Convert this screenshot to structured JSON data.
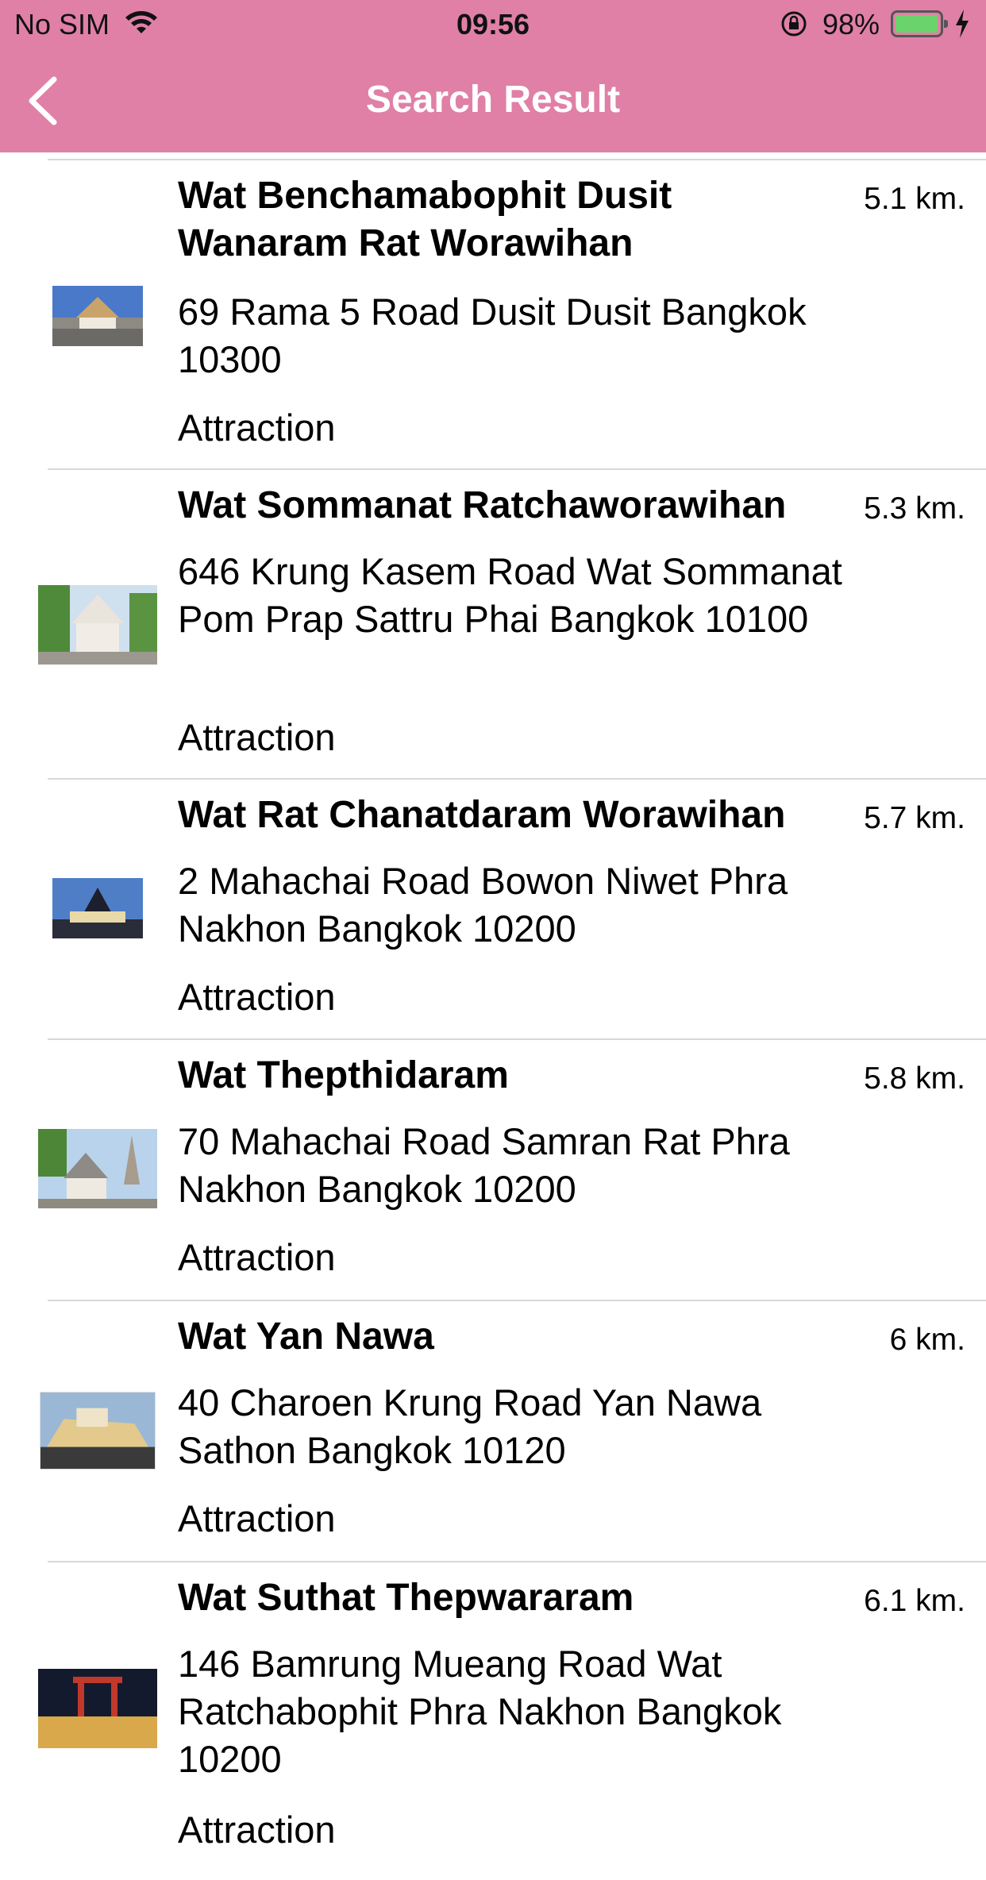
{
  "status_bar": {
    "carrier": "No SIM",
    "time": "09:56",
    "battery_percent": "98%",
    "battery_level": 0.98
  },
  "nav": {
    "title": "Search Result",
    "back_icon": "chevron-left-icon"
  },
  "colors": {
    "nav_background": "#e080a6",
    "battery_fill": "#6ad36b"
  },
  "results": [
    {
      "name": "Wat Benchamabophit Dusit Wanaram Rat Worawihan",
      "distance": "5.1 km.",
      "address": "69 Rama 5 Road Dusit Dusit Bangkok 10300",
      "category": "Attraction"
    },
    {
      "name": "Wat Sommanat Ratchaworawihan",
      "distance": "5.3 km.",
      "address": "646 Krung Kasem Road Wat Sommanat Pom Prap Sattru Phai Bangkok 10100",
      "category": "Attraction"
    },
    {
      "name": "Wat Rat Chanatdaram Worawihan",
      "distance": "5.7 km.",
      "address": "2 Mahachai Road Bowon Niwet Phra Nakhon Bangkok 10200",
      "category": "Attraction"
    },
    {
      "name": "Wat Thepthidaram",
      "distance": "5.8 km.",
      "address": "70 Mahachai Road Samran Rat Phra Nakhon Bangkok 10200",
      "category": "Attraction"
    },
    {
      "name": "Wat Yan Nawa",
      "distance": "6 km.",
      "address": "40 Charoen Krung Road Yan Nawa Sathon Bangkok 10120",
      "category": "Attraction"
    },
    {
      "name": "Wat Suthat Thepwararam",
      "distance": "6.1 km.",
      "address": "146 Bamrung Mueang Road Wat Ratchabophit Phra Nakhon Bangkok 10200",
      "category": "Attraction"
    }
  ]
}
